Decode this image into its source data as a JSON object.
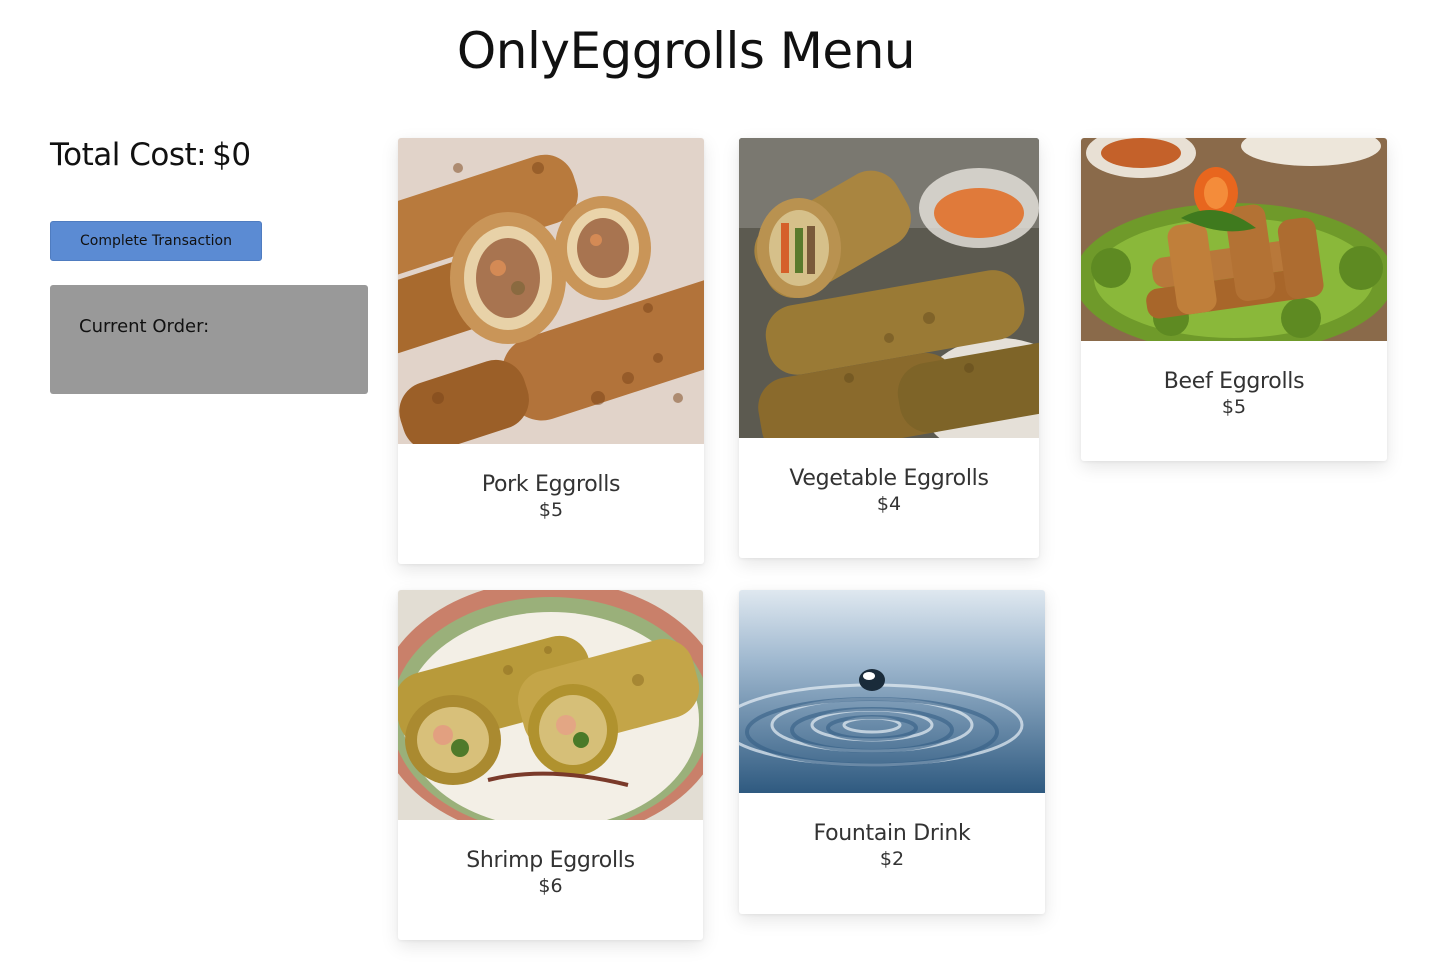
{
  "page": {
    "title": "OnlyEggrolls Menu"
  },
  "sidebar": {
    "total_label": "Total Cost:",
    "total_value": "$0",
    "complete_button": "Complete Transaction",
    "current_order_label": "Current Order:"
  },
  "menu": {
    "items": [
      {
        "name": "Pork Eggrolls",
        "price": "$5",
        "image": "pork-eggrolls-photo"
      },
      {
        "name": "Vegetable Eggrolls",
        "price": "$4",
        "image": "vegetable-eggrolls-photo"
      },
      {
        "name": "Beef Eggrolls",
        "price": "$5",
        "image": "beef-eggrolls-photo"
      },
      {
        "name": "Shrimp Eggrolls",
        "price": "$6",
        "image": "shrimp-eggrolls-photo"
      },
      {
        "name": "Fountain Drink",
        "price": "$2",
        "image": "water-drop-photo"
      }
    ]
  },
  "colors": {
    "button": "#5b8bd3",
    "order_box": "#999999",
    "text": "#111111"
  }
}
